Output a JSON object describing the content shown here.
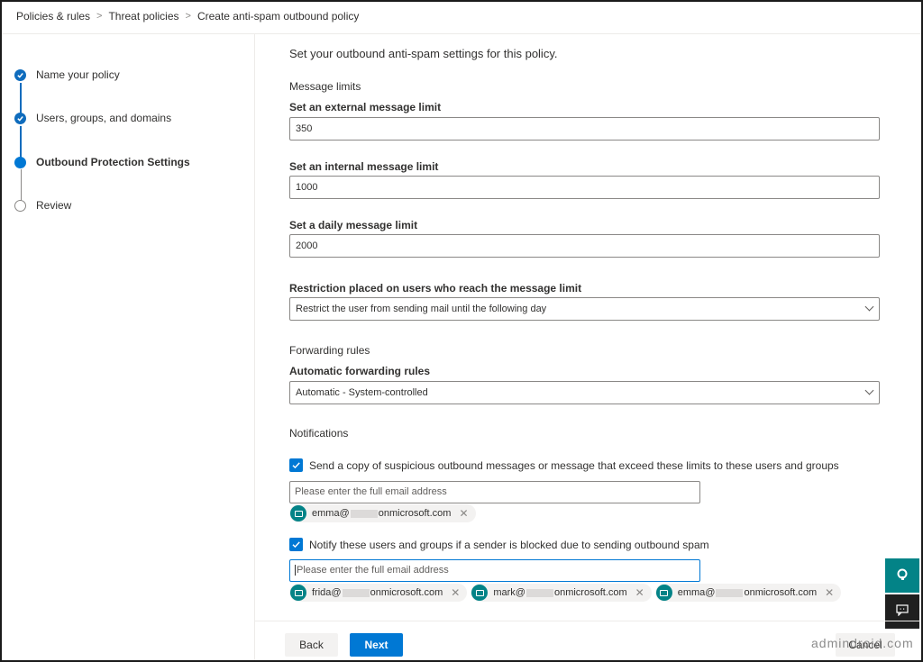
{
  "breadcrumb": [
    "Policies & rules",
    "Threat policies",
    "Create anti-spam outbound policy"
  ],
  "steps": [
    {
      "label": "Name your policy",
      "state": "done"
    },
    {
      "label": "Users, groups, and domains",
      "state": "done"
    },
    {
      "label": "Outbound Protection Settings",
      "state": "current"
    },
    {
      "label": "Review",
      "state": "pending"
    }
  ],
  "main": {
    "intro": "Set your outbound anti-spam settings for this policy.",
    "message_limits": {
      "heading": "Message limits",
      "external_label": "Set an external message limit",
      "external_value": "350",
      "internal_label": "Set an internal message limit",
      "internal_value": "1000",
      "daily_label": "Set a daily message limit",
      "daily_value": "2000"
    },
    "restriction": {
      "label": "Restriction placed on users who reach the message limit",
      "selected": "Restrict the user from sending mail until the following day"
    },
    "forwarding": {
      "heading": "Forwarding rules",
      "label": "Automatic forwarding rules",
      "selected": "Automatic - System-controlled"
    },
    "notifications": {
      "heading": "Notifications",
      "copy_checkbox": {
        "label": "Send a copy of suspicious outbound messages or message that exceed these limits to these users and groups",
        "checked": true,
        "placeholder": "Please enter the full email address",
        "recipients": [
          {
            "prefix": "emma@",
            "suffix": "onmicrosoft.com"
          }
        ]
      },
      "notify_checkbox": {
        "label": "Notify these users and groups if a sender is blocked due to sending outbound spam",
        "checked": true,
        "placeholder": "Please enter the full email address",
        "recipients": [
          {
            "prefix": "frida@",
            "suffix": "onmicrosoft.com"
          },
          {
            "prefix": "mark@",
            "suffix": "onmicrosoft.com"
          },
          {
            "prefix": "emma@",
            "suffix": "onmicrosoft.com"
          }
        ]
      }
    }
  },
  "footer": {
    "back": "Back",
    "next": "Next",
    "cancel": "Cancel"
  },
  "watermark": "admindroid.com",
  "colors": {
    "accent": "#0078d4",
    "chip_icon": "#038387",
    "help_fab": "#038387",
    "feedback_fab": "#1f1f1f"
  }
}
